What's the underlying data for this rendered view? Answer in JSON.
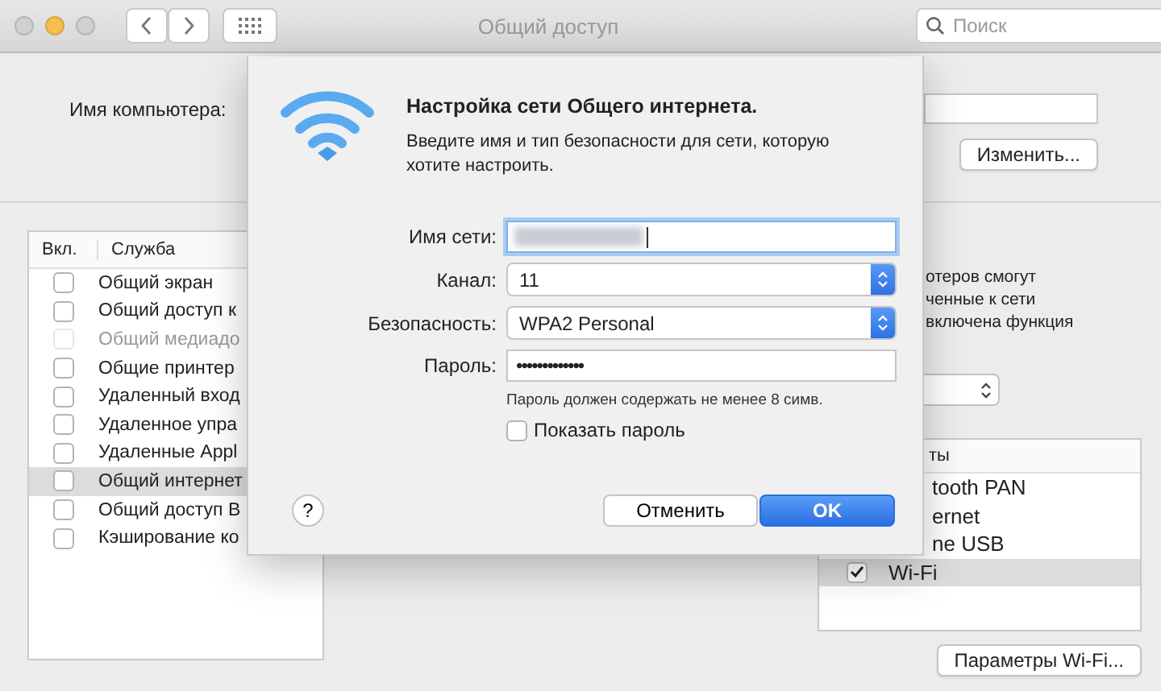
{
  "window": {
    "title": "Общий доступ",
    "search": {
      "placeholder": "Поиск"
    }
  },
  "computer_name": {
    "label": "Имя компьютера:",
    "edit_button": "Изменить..."
  },
  "services": {
    "columns": [
      "Вкл.",
      "Служба"
    ],
    "rows": [
      {
        "name": "Общий экран",
        "checked": false,
        "disabled": false,
        "selected": false
      },
      {
        "name": "Общий доступ к",
        "checked": false,
        "disabled": false,
        "selected": false
      },
      {
        "name": "Общий медиадо",
        "checked": false,
        "disabled": true,
        "selected": false
      },
      {
        "name": "Общие принтер",
        "checked": false,
        "disabled": false,
        "selected": false
      },
      {
        "name": "Удаленный вход",
        "checked": false,
        "disabled": false,
        "selected": false
      },
      {
        "name": "Удаленное упра",
        "checked": false,
        "disabled": false,
        "selected": false
      },
      {
        "name": "Удаленные Appl",
        "checked": false,
        "disabled": false,
        "selected": false
      },
      {
        "name": "Общий интернет",
        "checked": false,
        "disabled": false,
        "selected": true
      },
      {
        "name": "Общий доступ B",
        "checked": false,
        "disabled": false,
        "selected": false
      },
      {
        "name": "Кэширование ко",
        "checked": false,
        "disabled": false,
        "selected": false
      }
    ]
  },
  "right_panel": {
    "description_lines": [
      "отеров смогут",
      "ченные к сети",
      "включена функция"
    ],
    "ports_table": {
      "header": "ты",
      "rows": [
        {
          "name": "tooth PAN",
          "selected": false
        },
        {
          "name": "ernet",
          "selected": false
        },
        {
          "name": "ne USB",
          "selected": false
        },
        {
          "name": "Wi-Fi",
          "checked": true,
          "selected": true
        }
      ]
    },
    "wifi_button": "Параметры Wi-Fi..."
  },
  "dialog": {
    "title": "Настройка сети Общего интернета.",
    "description": "Введите имя и тип безопасности для сети, которую хотите настроить.",
    "fields": [
      {
        "kind": "text",
        "label": "Имя сети:",
        "focused": true
      },
      {
        "kind": "popup",
        "label": "Канал:",
        "value": "11"
      },
      {
        "kind": "popup",
        "label": "Безопасность:",
        "value": "WPA2 Personal"
      },
      {
        "kind": "password",
        "label": "Пароль:",
        "value": "•••••••••••••"
      }
    ],
    "hint": "Пароль должен содержать не менее 8 симв.",
    "show_password": {
      "label": "Показать пароль",
      "checked": false
    },
    "help_button": "?",
    "cancel_button": "Отменить",
    "ok_button": "OK"
  }
}
